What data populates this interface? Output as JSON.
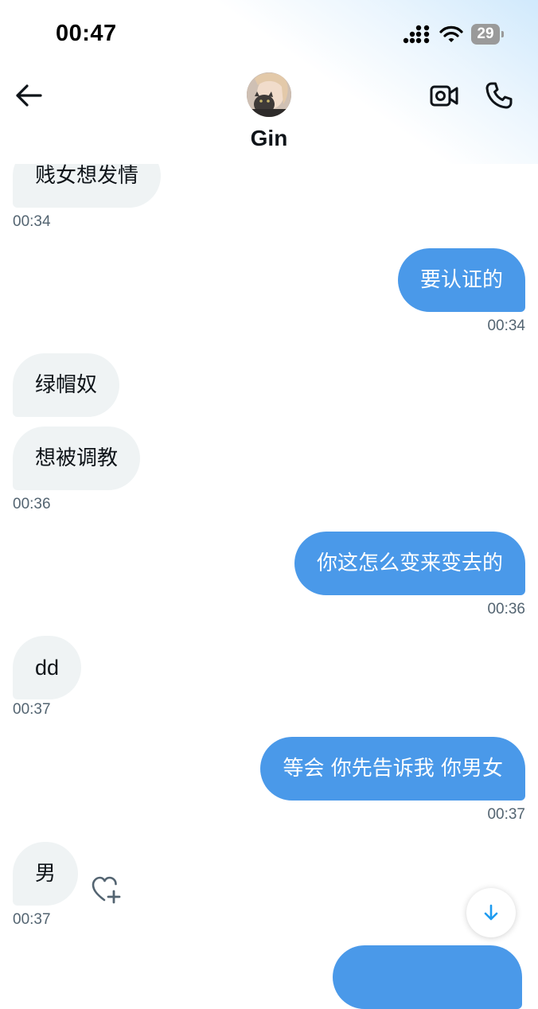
{
  "status_bar": {
    "time": "00:47",
    "battery": "29",
    "icons": [
      "signal-icon",
      "wifi-icon",
      "battery-icon"
    ]
  },
  "header": {
    "contact_name": "Gin",
    "icons": [
      "back-arrow-icon",
      "video-call-icon",
      "phone-icon"
    ]
  },
  "messages": [
    {
      "side": "in",
      "text": "贱女想发情",
      "time": "00:34"
    },
    {
      "side": "out",
      "text": "要认证的",
      "time": "00:34"
    },
    {
      "side": "in",
      "text": "绿帽奴",
      "time": ""
    },
    {
      "side": "in",
      "text": "想被调教",
      "time": "00:36"
    },
    {
      "side": "out",
      "text": "你这怎么变来变去的",
      "time": "00:36"
    },
    {
      "side": "in",
      "text": "dd",
      "time": "00:37"
    },
    {
      "side": "out",
      "text": "等会 你先告诉我 你男女",
      "time": "00:37"
    },
    {
      "side": "in",
      "text": "男",
      "time": "00:37"
    }
  ],
  "colors": {
    "incoming_bubble": "#eff3f4",
    "outgoing_bubble": "#4a99e9",
    "accent": "#1d9bf0",
    "timestamp": "#536471"
  }
}
